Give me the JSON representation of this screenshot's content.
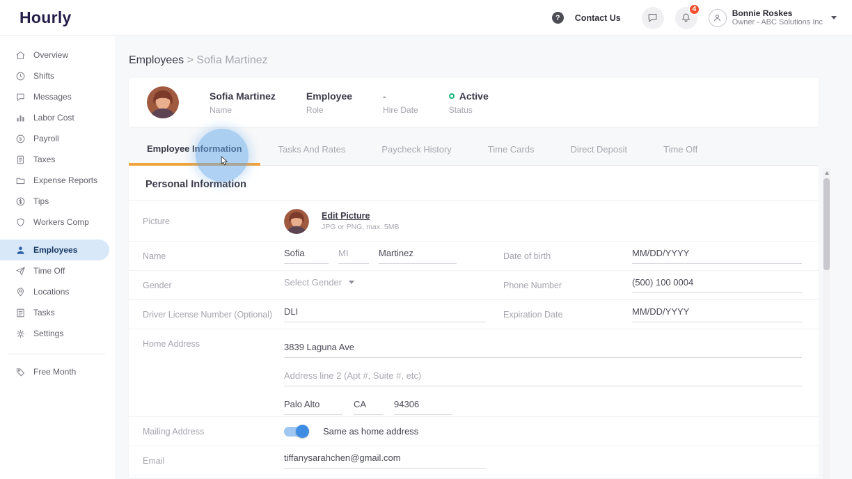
{
  "colors": {
    "accent_orange": "#F2A33C",
    "primary_blue": "#3E8DE3",
    "active_item_bg": "#D8E8F9",
    "status_green": "#17B478",
    "badge_red": "#F4502E",
    "logo_navy": "#241D49"
  },
  "header": {
    "logo": "Hourly",
    "help": "?",
    "contact_us": "Contact Us",
    "notification_count": "4",
    "user": {
      "name": "Bonnie Roskes",
      "role": "Owner - ABC Solutions Inc"
    }
  },
  "sidebar": {
    "items": [
      {
        "label": "Overview",
        "icon": "home"
      },
      {
        "label": "Shifts",
        "icon": "clock"
      },
      {
        "label": "Messages",
        "icon": "chat"
      },
      {
        "label": "Labor Cost",
        "icon": "bar-chart"
      },
      {
        "label": "Payroll",
        "icon": "dollar-circle"
      },
      {
        "label": "Taxes",
        "icon": "document"
      },
      {
        "label": "Expense Reports",
        "icon": "folder"
      },
      {
        "label": "Tips",
        "icon": "coin"
      },
      {
        "label": "Workers Comp",
        "icon": "shield"
      },
      {
        "label": "Employees",
        "icon": "person",
        "active": true
      },
      {
        "label": "Time Off",
        "icon": "paper-plane"
      },
      {
        "label": "Locations",
        "icon": "map-pin"
      },
      {
        "label": "Tasks",
        "icon": "checklist"
      },
      {
        "label": "Settings",
        "icon": "gear"
      },
      {
        "label": "Free Month",
        "icon": "tag"
      }
    ]
  },
  "breadcrumb": {
    "parent": "Employees",
    "separator": ">",
    "current": "Sofia Martinez"
  },
  "profile": {
    "name": {
      "value": "Sofia Martinez",
      "label": "Name"
    },
    "role": {
      "value": "Employee",
      "label": "Role"
    },
    "hire_date": {
      "value": "-",
      "label": "Hire Date"
    },
    "status": {
      "value": "Active",
      "label": "Status"
    }
  },
  "tabs": [
    {
      "label": "Employee Information",
      "active": true
    },
    {
      "label": "Tasks And Rates"
    },
    {
      "label": "Paycheck History"
    },
    {
      "label": "Time Cards"
    },
    {
      "label": "Direct Deposit"
    },
    {
      "label": "Time Off"
    }
  ],
  "personal_info": {
    "title": "Personal Information",
    "picture": {
      "label": "Picture",
      "edit_link": "Edit Picture",
      "hint": "JPG or PNG, max. 5MB"
    },
    "name": {
      "label": "Name",
      "first": "Sofia",
      "mi_placeholder": "MI",
      "last": "Martinez"
    },
    "dob": {
      "label": "Date of birth",
      "placeholder": "MM/DD/YYYY"
    },
    "gender": {
      "label": "Gender",
      "value": "Select Gender"
    },
    "phone": {
      "label": "Phone Number",
      "value": "(500) 100 0004"
    },
    "license": {
      "label": "Driver License Number (Optional)",
      "value": "DLI"
    },
    "expiration": {
      "label": "Expiration Date",
      "placeholder": "MM/DD/YYYY"
    },
    "home_address": {
      "label": "Home Address",
      "line1": "3839 Laguna Ave",
      "line2_placeholder": "Address line 2 (Apt #, Suite #, etc)",
      "city": "Palo Alto",
      "state": "CA",
      "zip": "94306"
    },
    "mailing": {
      "label": "Mailing Address",
      "toggle_label": "Same as home address",
      "toggle_on": true
    },
    "email": {
      "label": "Email",
      "value": "tiffanysarahchen@gmail.com"
    }
  }
}
